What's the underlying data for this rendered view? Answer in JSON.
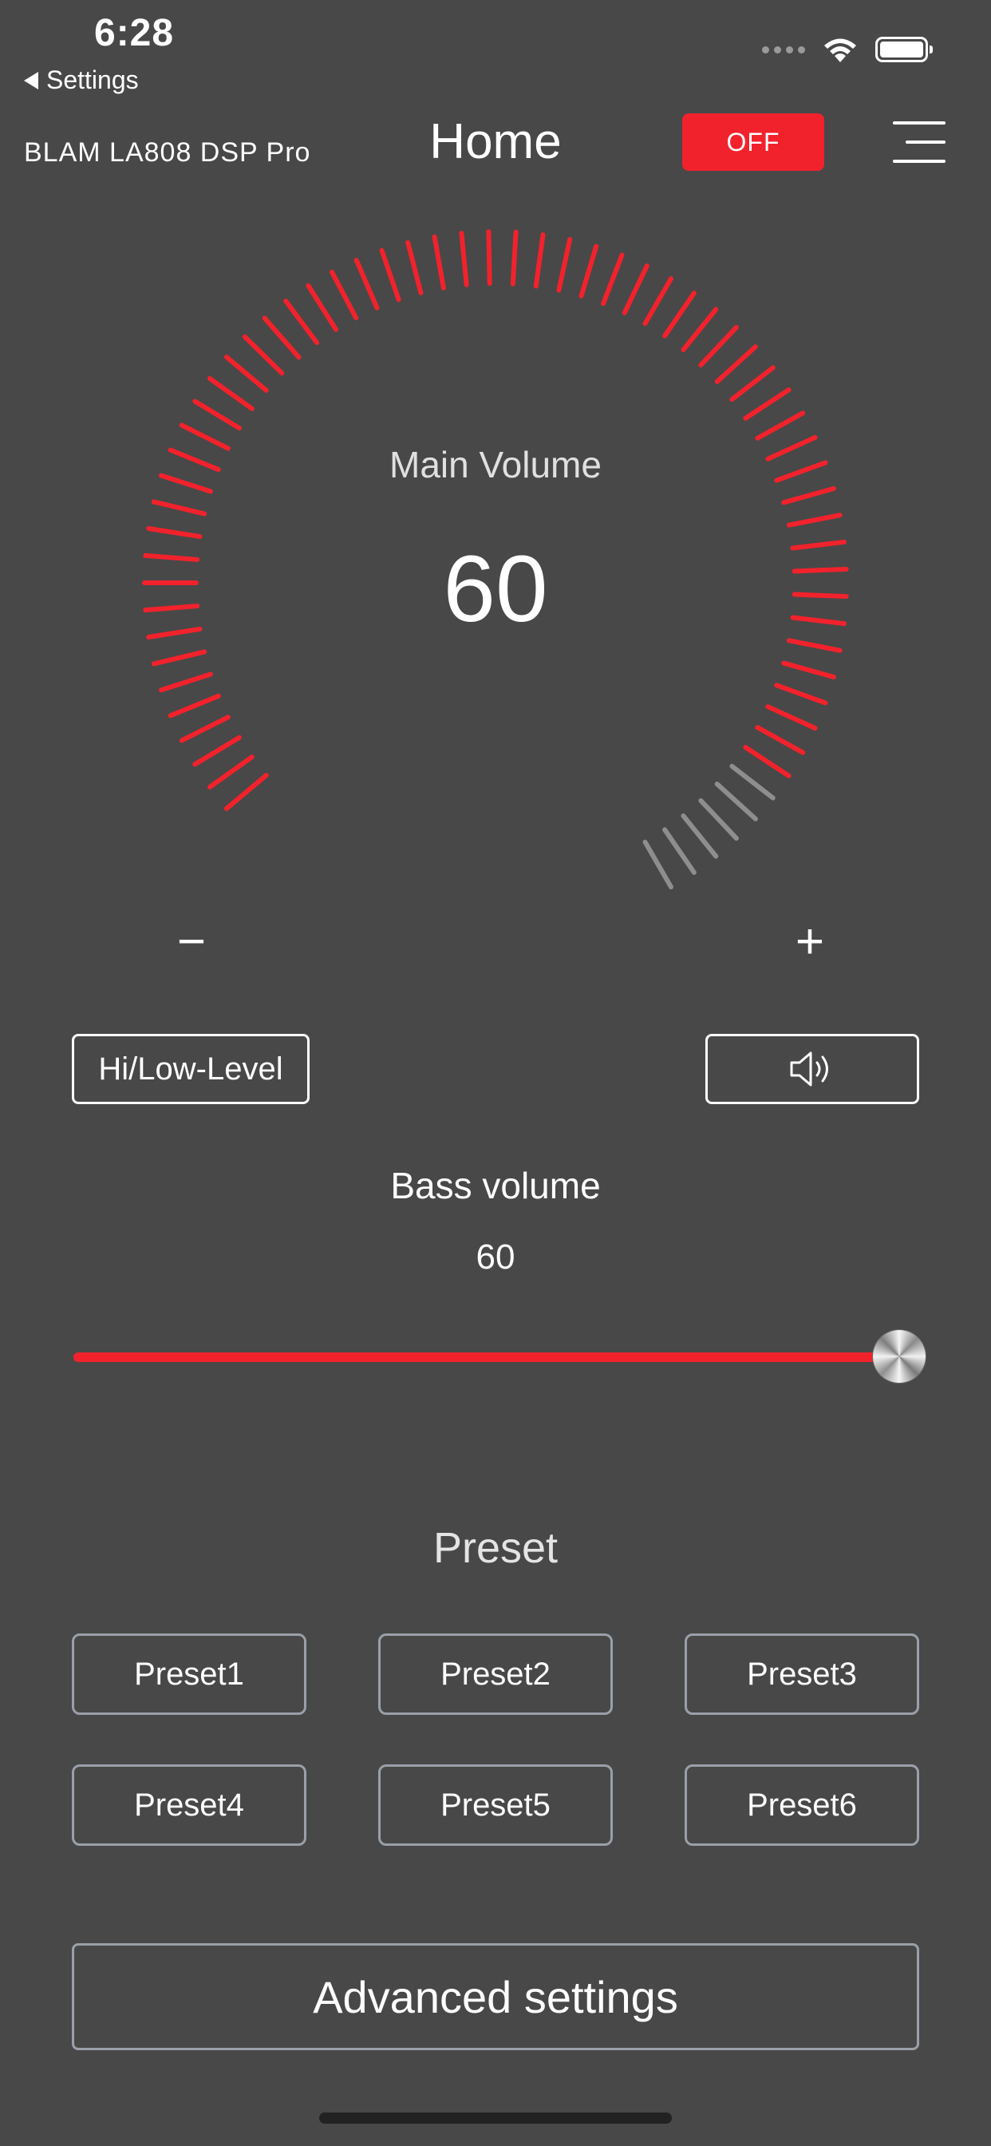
{
  "status_bar": {
    "time": "6:28",
    "back_label": "Settings",
    "icons": [
      "signal-dots-icon",
      "wifi-icon",
      "battery-icon"
    ]
  },
  "header": {
    "device_name": "BLAM LA808 DSP Pro",
    "title": "Home",
    "power_label": "OFF",
    "menu_icon": "hamburger-menu-icon"
  },
  "main_volume": {
    "label": "Main Volume",
    "value": "60",
    "level_fraction": 0.9,
    "minus_label": "−",
    "plus_label": "+"
  },
  "mode": {
    "input_label": "Hi/Low-Level",
    "speaker_icon": "speaker-icon"
  },
  "bass": {
    "label": "Bass volume",
    "value": "60",
    "level_fraction": 1.0
  },
  "presets": {
    "title": "Preset",
    "items": [
      "Preset1",
      "Preset2",
      "Preset3",
      "Preset4",
      "Preset5",
      "Preset6"
    ]
  },
  "advanced": {
    "label": "Advanced settings"
  },
  "colors": {
    "background": "#484848",
    "accent": "#f2222c",
    "inactive_tick": "#8e8e8e",
    "outline": "#9aa0a8"
  }
}
